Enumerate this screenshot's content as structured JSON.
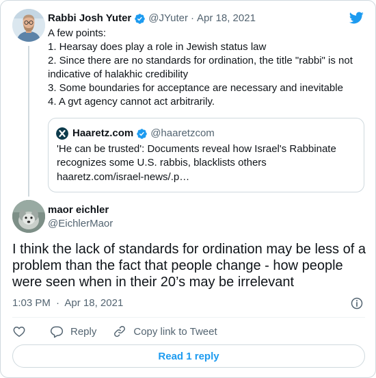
{
  "colors": {
    "brand": "#1d9bf0",
    "text": "#0f1419",
    "muted": "#536471",
    "border": "#cfd9de"
  },
  "parent_tweet": {
    "author_name": "Rabbi Josh Yuter",
    "handle": "@JYuter",
    "separator": "·",
    "date": "Apr 18, 2021",
    "lines": [
      "A few points:",
      "1. Hearsay does play a role in Jewish status law",
      "2. Since there are no standards for ordination, the title \"rabbi\" is not indicative of halakhic credibility",
      "3. Some boundaries for acceptance are necessary and inevitable",
      "4. A gvt agency cannot act arbitrarily."
    ],
    "quote": {
      "source_name": "Haaretz.com",
      "source_handle": "@haaretzcom",
      "text": "'He can be trusted': Documents reveal how Israel's Rabbinate recognizes some U.S. rabbis, blacklists others",
      "url": "haaretz.com/israel-news/.p…"
    }
  },
  "tweet": {
    "author_name": "maor eichler",
    "handle": "@EichlerMaor",
    "text": "I think the lack of standards for ordination may be less of a problem than the fact that people change - how people were seen when in their 20’s may be irrelevant",
    "time": "1:03 PM",
    "separator": "·",
    "date": "Apr 18, 2021"
  },
  "actions": {
    "reply_label": "Reply",
    "copy_link_label": "Copy link to Tweet"
  },
  "read_reply_label": "Read 1 reply",
  "icons": {
    "twitter": "twitter-bird-icon",
    "verified": "verified-badge-icon",
    "info": "info-icon",
    "like": "heart-icon",
    "reply": "reply-bubble-icon",
    "link": "link-icon"
  }
}
